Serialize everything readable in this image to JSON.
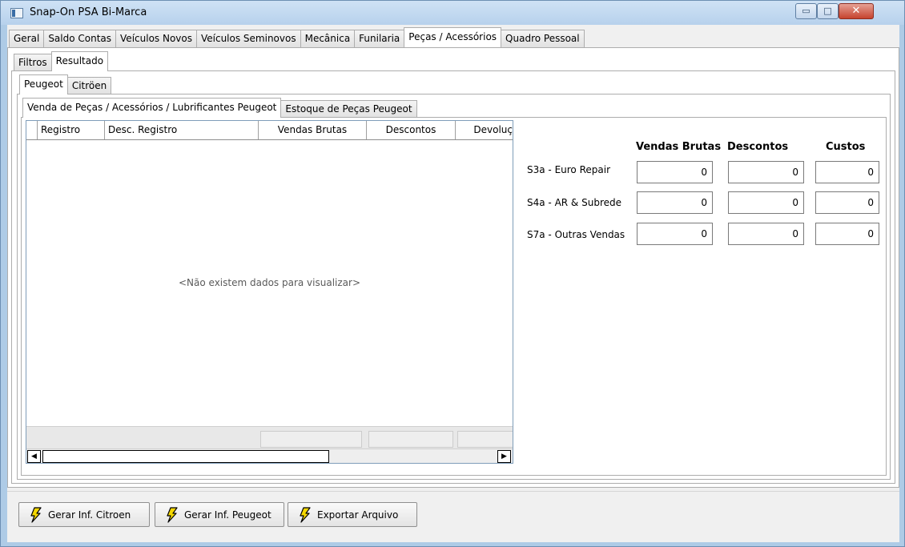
{
  "window": {
    "title": "Snap-On PSA Bi-Marca",
    "min_glyph": "▭",
    "max_glyph": "□",
    "close_glyph": "✕"
  },
  "main_tabs": [
    "Geral",
    "Saldo Contas",
    "Veículos Novos",
    "Veículos Seminovos",
    "Mecânica",
    "Funilaria",
    "Peças / Acessórios",
    "Quadro Pessoal"
  ],
  "main_tabs_active": "Peças / Acessórios",
  "view_tabs": [
    "Filtros",
    "Resultado"
  ],
  "view_tabs_active": "Resultado",
  "brand_tabs": [
    "Peugeot",
    "Citröen"
  ],
  "brand_tabs_active": "Peugeot",
  "report_tabs": [
    "Venda de Peças / Acessórios / Lubrificantes Peugeot",
    "Estoque de Peças Peugeot"
  ],
  "report_tabs_active": "Venda de Peças / Acessórios / Lubrificantes Peugeot",
  "grid": {
    "columns": [
      "Registro",
      "Desc. Registro",
      "Vendas Brutas",
      "Descontos",
      "Devoluç"
    ],
    "empty_message": "<Não existem dados para visualizar>"
  },
  "summary": {
    "columns": [
      "Vendas Brutas",
      "Descontos",
      "Custos"
    ],
    "rows": [
      {
        "label": "S3a - Euro Repair",
        "values": [
          "0",
          "0",
          "0"
        ]
      },
      {
        "label": "S4a - AR & Subrede",
        "values": [
          "0",
          "0",
          "0"
        ]
      },
      {
        "label": "S7a - Outras Vendas",
        "values": [
          "0",
          "0",
          "0"
        ]
      }
    ]
  },
  "buttons": [
    {
      "label": "Gerar Inf. Citroen",
      "icon": "lightning-icon"
    },
    {
      "label": "Gerar Inf. Peugeot",
      "icon": "lightning-icon"
    },
    {
      "label": "Exportar Arquivo",
      "icon": "lightning-icon"
    }
  ],
  "colors": {
    "titlebar": "#b7d1ec",
    "client_bg": "#f0f0f0",
    "bolt_fill": "#f5d800"
  }
}
